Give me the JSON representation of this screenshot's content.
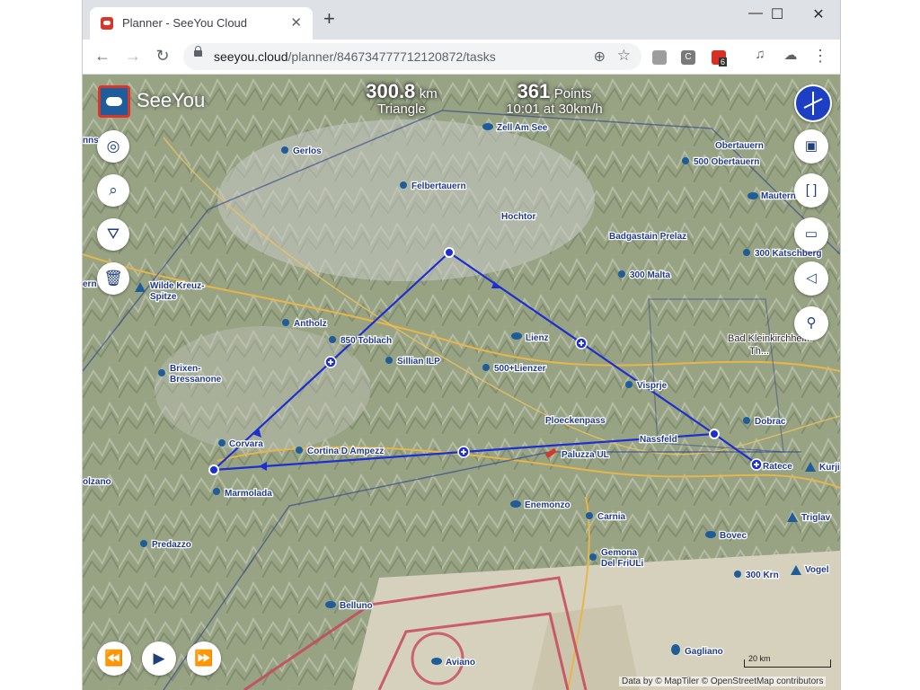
{
  "browser": {
    "tab_title": "Planner - SeeYou Cloud",
    "tab_close": "✕",
    "new_tab": "+",
    "url_host": "seeyou.cloud",
    "url_path": "/planner/846734777712120872/tasks",
    "window_controls": {
      "minimize": "—",
      "maximize": "☐",
      "close": "✕"
    },
    "nav": {
      "back": "←",
      "forward": "→",
      "reload": "↻"
    },
    "extensions": [
      {
        "name": "ext-1-icon",
        "color": "#9e9e9e"
      },
      {
        "name": "ext-c-icon",
        "label": "C",
        "color": "#7a7a7a"
      },
      {
        "name": "ext-badge-icon",
        "badge": "6",
        "color": "#d93025"
      }
    ]
  },
  "app": {
    "brand": "SeeYou",
    "accent": "#1f5d9a"
  },
  "task": {
    "distance_value": "300.8",
    "distance_unit": "km",
    "shape": "Triangle",
    "points_value": "361",
    "points_unit": "Points",
    "time_speed": "10:01 at 30km/h"
  },
  "controls": {
    "left": [
      {
        "name": "navigate-button",
        "icon": "◎"
      },
      {
        "name": "search-button",
        "icon": "⌕"
      },
      {
        "name": "task-tool-button",
        "icon": "⛛"
      },
      {
        "name": "delete-button",
        "icon": "🗑"
      }
    ],
    "right": [
      {
        "name": "layers-button",
        "icon": "▣"
      },
      {
        "name": "fullscreen-button",
        "icon": "[ ]"
      },
      {
        "name": "ruler-button",
        "icon": "▭"
      },
      {
        "name": "measure-button",
        "icon": "◁"
      },
      {
        "name": "place-button",
        "icon": "⚲"
      }
    ],
    "playback": [
      {
        "name": "rewind-button",
        "icon": "⏪"
      },
      {
        "name": "play-button",
        "icon": "▶"
      },
      {
        "name": "fast-forward-button",
        "icon": "⏩"
      }
    ]
  },
  "map": {
    "scale_label": "20 km",
    "attribution": "Data by © MapTiler © OpenStreetMap contributors",
    "places": [
      {
        "name": "Gerlos",
        "kind": "town"
      },
      {
        "name": "Felbertauern",
        "kind": "town"
      },
      {
        "name": "Zell Am See",
        "kind": "airfield"
      },
      {
        "name": "Hochtor",
        "kind": "pass"
      },
      {
        "name": "Obertauern",
        "kind": "pass"
      },
      {
        "name": "500 Obertauern",
        "kind": "town"
      },
      {
        "name": "Mauterndorf",
        "kind": "airfield"
      },
      {
        "name": "Badgastain Prelaz",
        "kind": "pass"
      },
      {
        "name": "300 Katschberg",
        "kind": "town"
      },
      {
        "name": "300 Malta",
        "kind": "town"
      },
      {
        "name": "Wilde Kreuz-",
        "kind": "peak"
      },
      {
        "name": "Spitze",
        "kind": "peak"
      },
      {
        "name": "Antholz",
        "kind": "town"
      },
      {
        "name": "850 Toblach",
        "kind": "town"
      },
      {
        "name": "Sillian ILP",
        "kind": "town"
      },
      {
        "name": "Lienz",
        "kind": "airfield"
      },
      {
        "name": "500+Lienzer",
        "kind": "town"
      },
      {
        "name": "Visprje",
        "kind": "town"
      },
      {
        "name": "Bad Kleinkirchheim",
        "kind": "city"
      },
      {
        "name": "Th...",
        "kind": "city"
      },
      {
        "name": "Brixen-",
        "kind": "town"
      },
      {
        "name": "Bressanone",
        "kind": "town"
      },
      {
        "name": "Ploeckenpass",
        "kind": "pass"
      },
      {
        "name": "Dobrac",
        "kind": "town"
      },
      {
        "name": "Nassfeld",
        "kind": "pass"
      },
      {
        "name": "Corvara",
        "kind": "town"
      },
      {
        "name": "Cortina D Ampezz",
        "kind": "town"
      },
      {
        "name": "Paluzza UL",
        "kind": "airfield"
      },
      {
        "name": "Ratece",
        "kind": "turnpoint"
      },
      {
        "name": "Kurji",
        "kind": "peak"
      },
      {
        "name": "Marmolada",
        "kind": "town"
      },
      {
        "name": "Enemonzo",
        "kind": "airfield"
      },
      {
        "name": "Carnia",
        "kind": "town"
      },
      {
        "name": "Triglav",
        "kind": "peak"
      },
      {
        "name": "Predazzo",
        "kind": "town"
      },
      {
        "name": "Bovec",
        "kind": "airfield"
      },
      {
        "name": "Gemona",
        "kind": "town"
      },
      {
        "name": "Del FriULi",
        "kind": "town"
      },
      {
        "name": "300 Krn",
        "kind": "town"
      },
      {
        "name": "Vogel",
        "kind": "peak"
      },
      {
        "name": "Belluno",
        "kind": "airfield"
      },
      {
        "name": "Aviano",
        "kind": "airfield"
      },
      {
        "name": "Gagliano",
        "kind": "airfield"
      },
      {
        "name": "olzano",
        "kind": "edge"
      },
      {
        "name": "ern",
        "kind": "edge"
      },
      {
        "name": "nns",
        "kind": "edge"
      }
    ]
  }
}
